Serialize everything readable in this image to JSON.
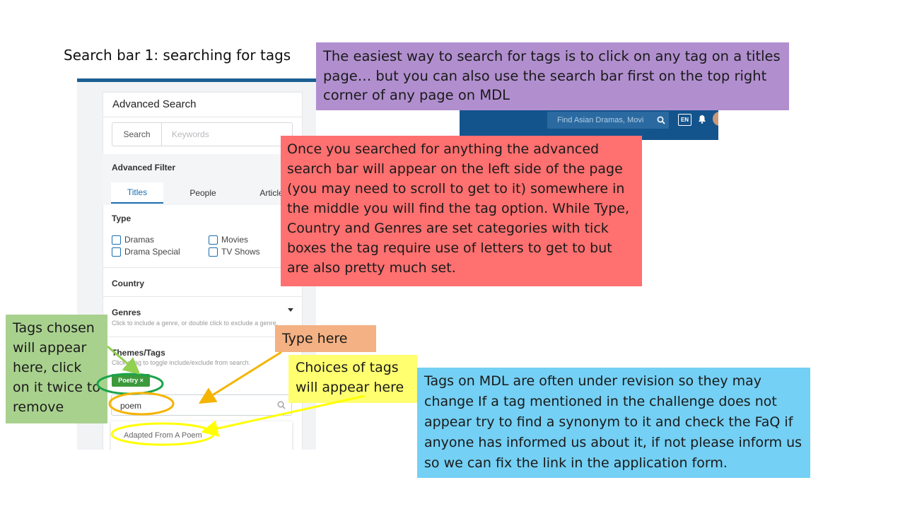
{
  "slide_title": "Search bar 1: searching for tags",
  "panel": {
    "card_title": "Advanced Search",
    "search_button": "Search",
    "keywords_placeholder": "Keywords",
    "advanced_filter": "Advanced Filter",
    "close": "×",
    "tabs": [
      "Titles",
      "People",
      "Articles"
    ],
    "type_label": "Type",
    "type_options": [
      "Dramas",
      "Movies",
      "Drama Special",
      "TV Shows"
    ],
    "country_label": "Country",
    "genres_label": "Genres",
    "genres_hint": "Click to include a genre, or double click to exclude a genre.",
    "themes_label": "Themes/Tags",
    "themes_hint": "Click a tag to toggle include/exclude from search.",
    "chip_label": "Poetry ×",
    "tag_input_value": "poem",
    "dropdown_option": "Adapted From A Poem"
  },
  "header": {
    "search_placeholder": "Find Asian Dramas, Movi",
    "lang": "EN"
  },
  "callouts": {
    "purple": "The easiest way to search for tags is to click on any tag on a titles page… but you can also use the search bar first on the top right corner of any page on MDL",
    "red": "Once you searched for anything the advanced search bar will appear on the left side of the page (you may need to scroll to get to it) somewhere in the middle you will find the tag option. While Type, Country and Genres are set categories with tick boxes the tag require use of letters to get to but are also pretty much set.",
    "green": "Tags chosen will appear here, click on it twice to remove",
    "orange": "Type here",
    "yellow": "Choices of tags will appear here",
    "blue": "Tags on MDL are often under revision so they  may change If a tag mentioned in the challenge does not appear try to find a synonym to it and check the FaQ if anyone has informed us about it, if not please inform us so we can fix the link in the application form."
  },
  "colors": {
    "mdl_blue": "#14548c",
    "purple": "#b18fcf",
    "red": "#ff7070",
    "green": "#a9d18e",
    "orange": "#f4b183",
    "yellow": "#ffff70",
    "blue": "#74d0f4"
  }
}
